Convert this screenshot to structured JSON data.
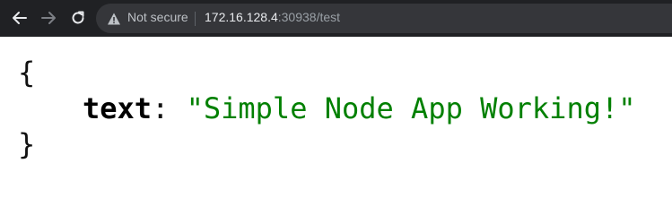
{
  "browser": {
    "security_label": "Not secure",
    "url_host": "172.16.128.4",
    "url_rest": ":30938/test",
    "icons": {
      "back": "back-arrow-icon",
      "forward": "forward-arrow-icon",
      "reload": "reload-icon",
      "security": "warning-triangle-icon"
    }
  },
  "json_view": {
    "open_brace": "{",
    "key": "text",
    "colon": ": ",
    "value": "\"Simple Node App Working!\"",
    "close_brace": "}",
    "colors": {
      "string": "#008000",
      "key": "#000000"
    }
  }
}
